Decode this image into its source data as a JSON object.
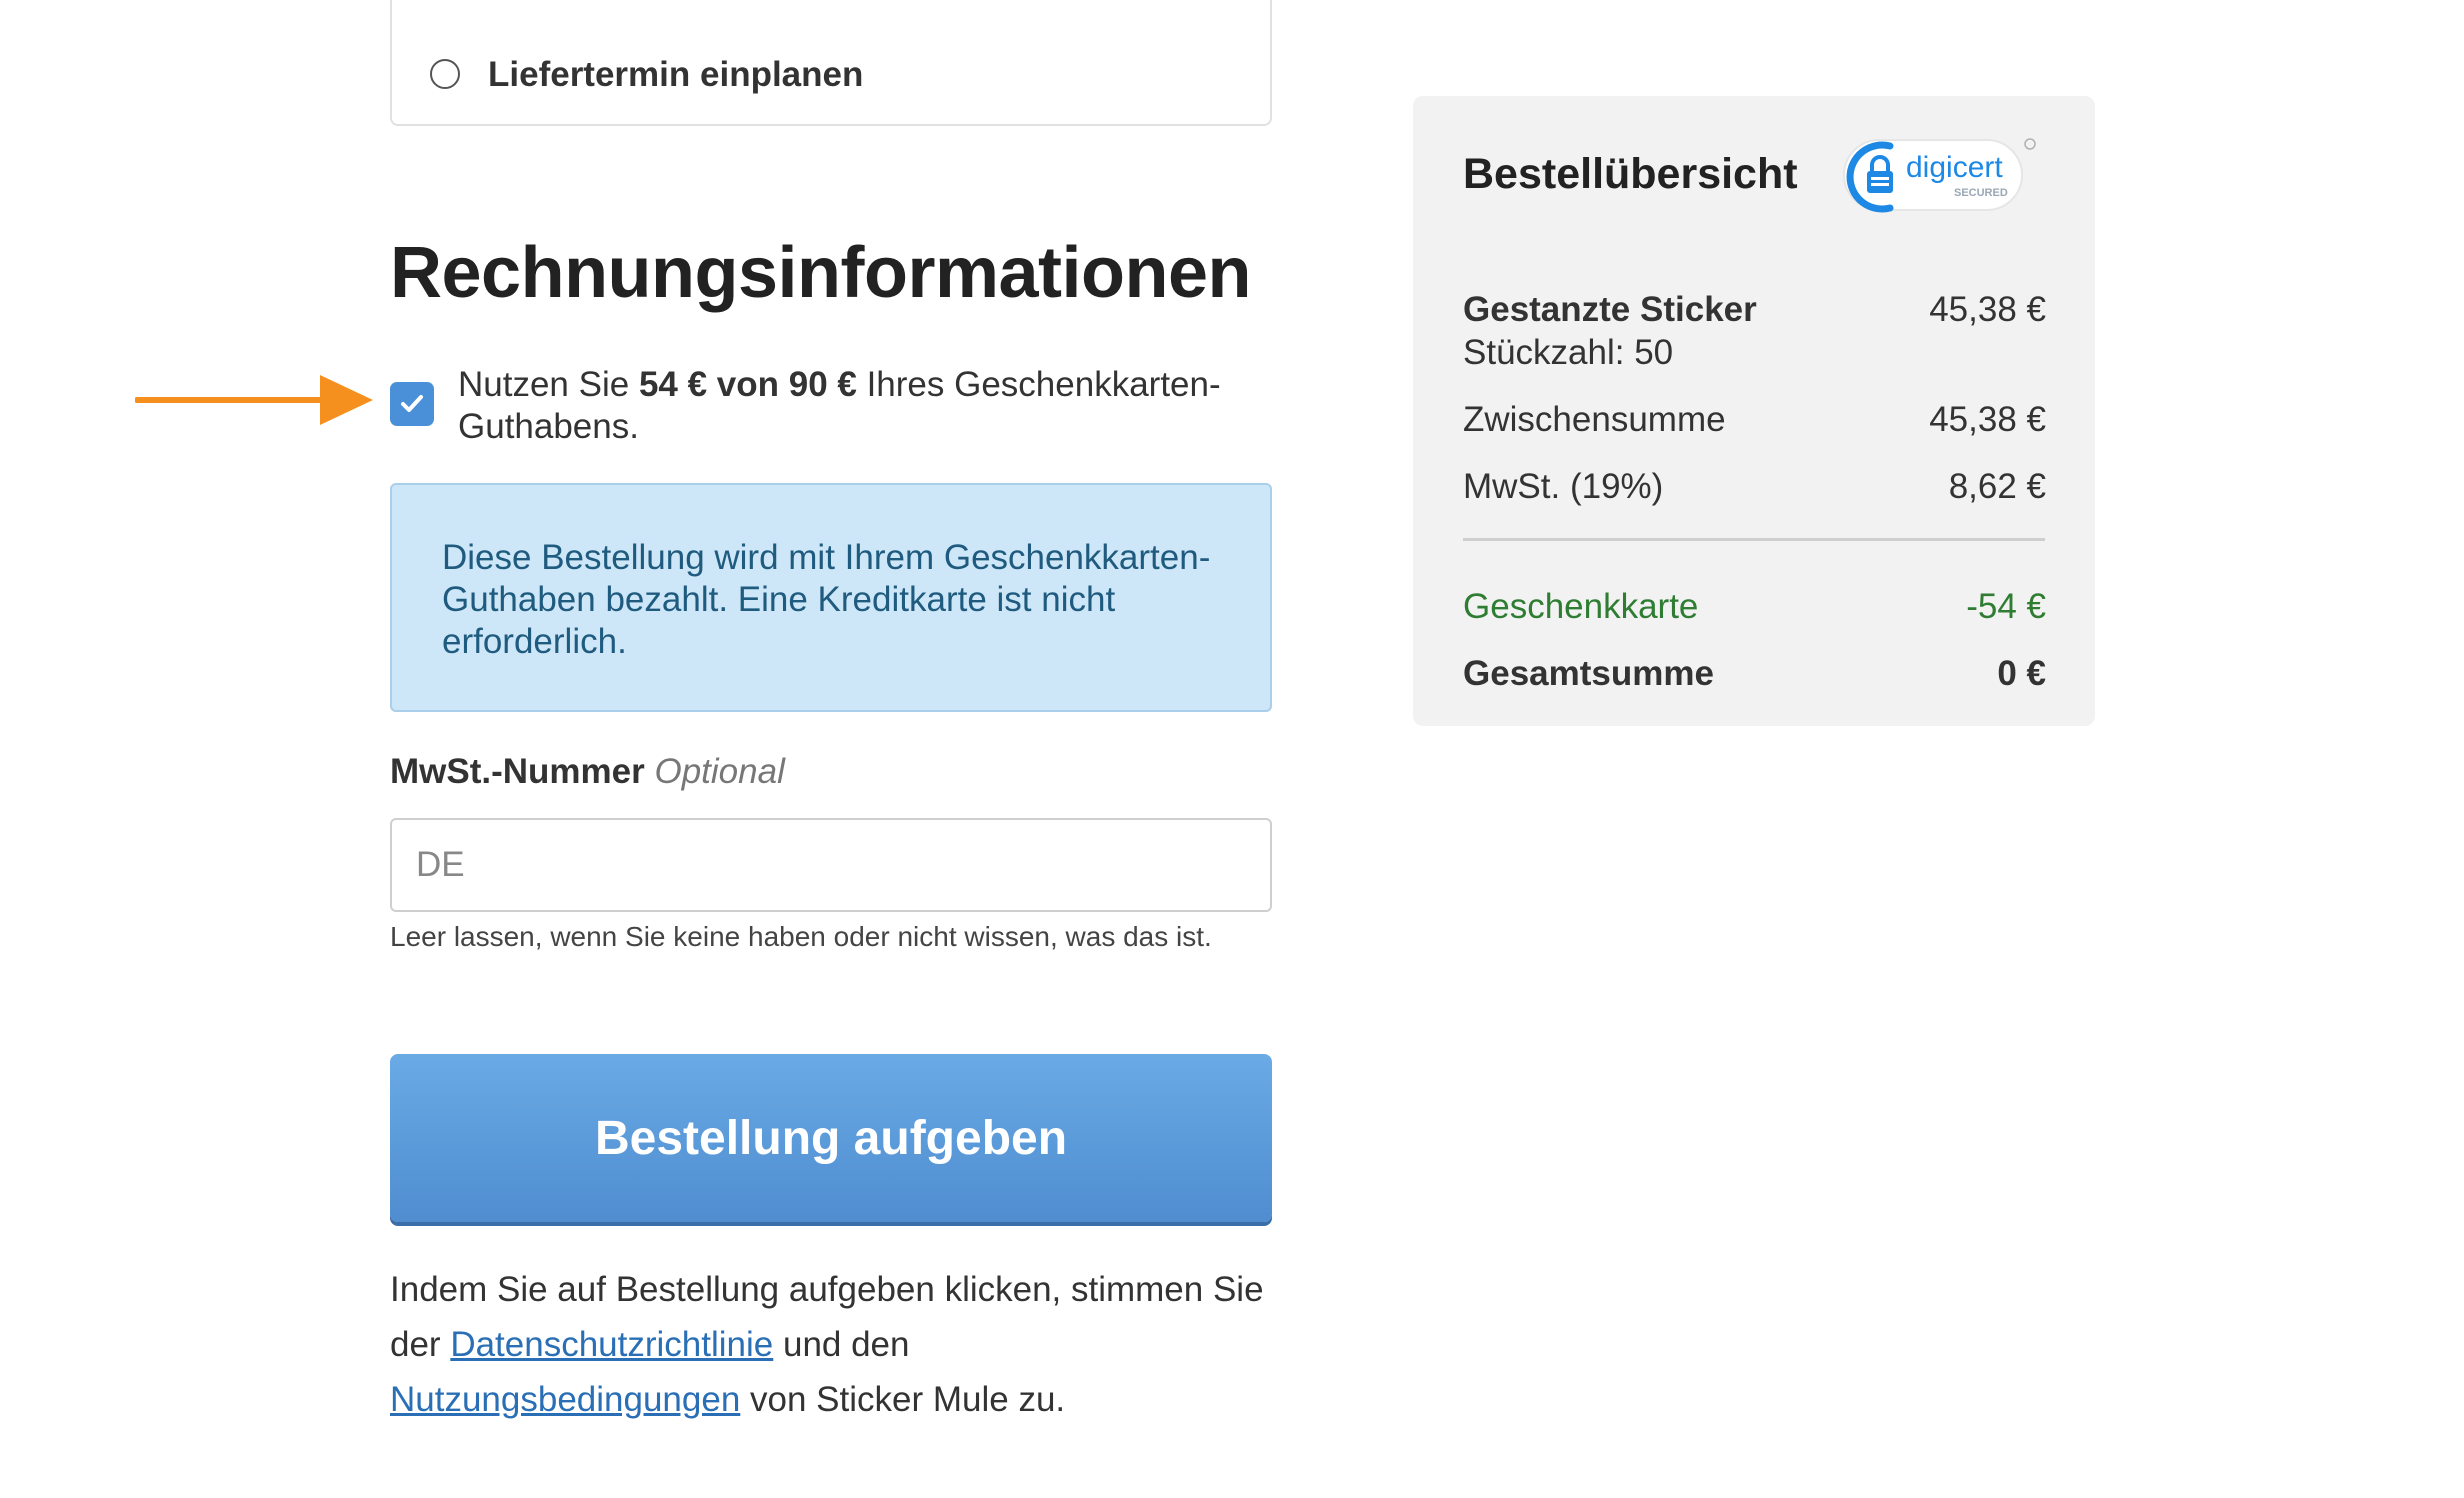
{
  "delivery": {
    "option_label": "Liefertermin einplanen"
  },
  "billing": {
    "heading": "Rechnungsinformationen",
    "gift_card": {
      "prefix": "Nutzen Sie ",
      "amount": "54 € von 90 €",
      "suffix": " Ihres Geschenkkarten-Guthabens.",
      "checked": true
    },
    "info_message": "Diese Bestellung wird mit Ihrem Geschenkkarten-Guthaben bezahlt. Eine Kreditkarte ist nicht erforderlich.",
    "vat": {
      "label": "MwSt.-Nummer",
      "optional": "Optional",
      "placeholder": "DE",
      "help": "Leer lassen, wenn Sie keine haben oder nicht wissen, was das ist."
    },
    "submit_label": "Bestellung aufgeben",
    "terms": {
      "text1": "Indem Sie auf Bestellung aufgeben klicken, stimmen Sie der ",
      "privacy_link": "Datenschutzrichtlinie",
      "text2": " und den ",
      "terms_link": "Nutzungsbedingungen",
      "text3": " von Sticker Mule zu."
    }
  },
  "summary": {
    "title": "Bestellübersicht",
    "badge": {
      "brand": "digicert",
      "sub": "SECURED",
      "icon": "lock-icon"
    },
    "item": {
      "name": "Gestanzte Sticker",
      "qty": "Stückzahl: 50",
      "price": "45,38 €"
    },
    "subtotal": {
      "label": "Zwischensumme",
      "value": "45,38 €"
    },
    "vat": {
      "label": "MwSt. (19%)",
      "value": "8,62 €"
    },
    "gift_card": {
      "label": "Geschenkkarte",
      "value": "-54 €"
    },
    "total": {
      "label": "Gesamtsumme",
      "value": "0 €"
    }
  },
  "colors": {
    "accent": "#4a90d9",
    "arrow": "#f5901e",
    "green": "#2e7d32",
    "info_bg": "#cde6f8"
  }
}
